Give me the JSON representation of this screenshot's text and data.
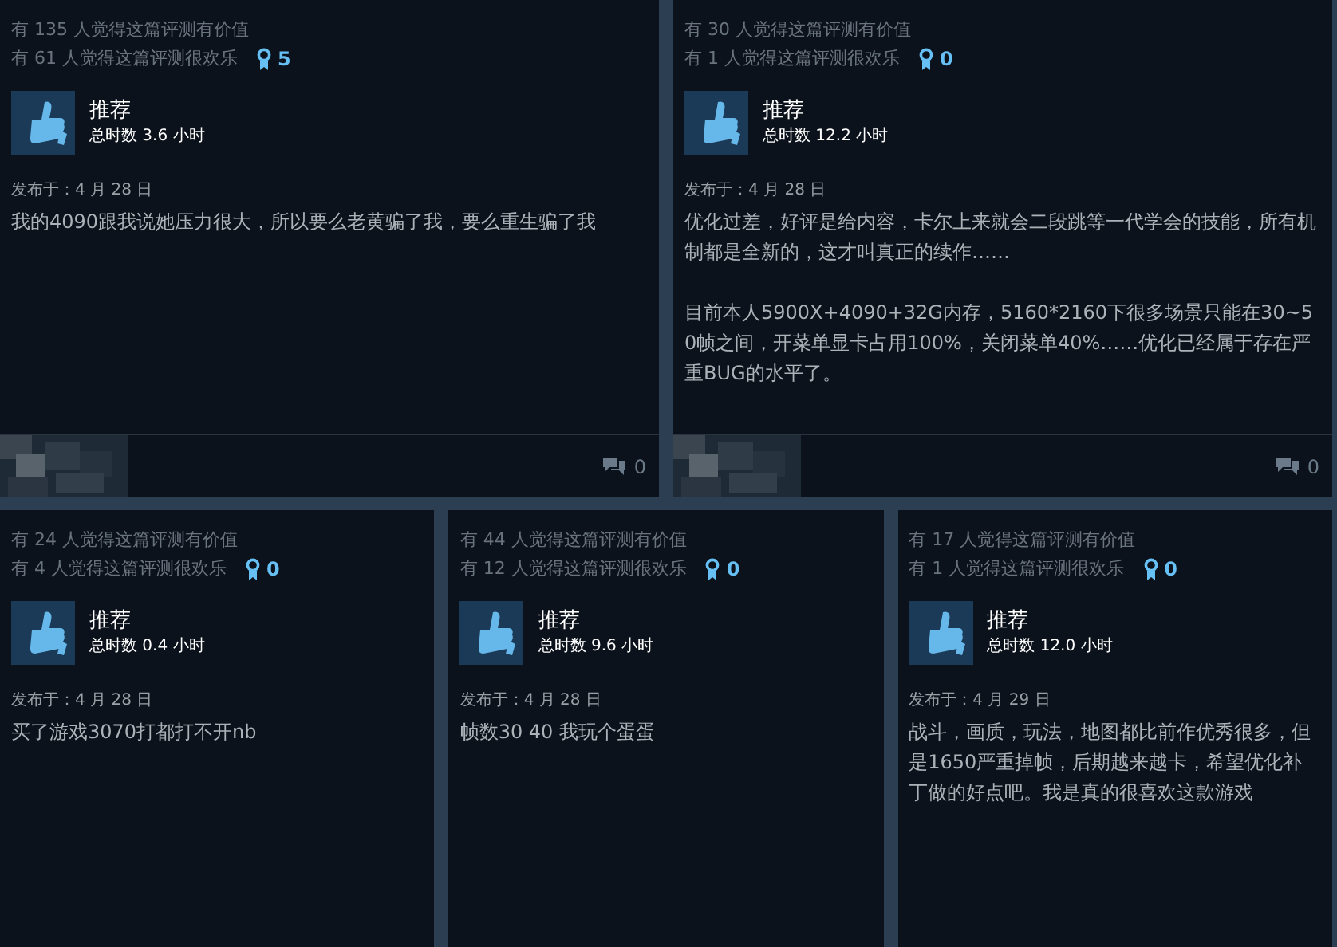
{
  "reviews": [
    {
      "helpful": "有 135 人觉得这篇评测有价值",
      "funny": "有 61 人觉得这篇评测很欢乐",
      "awards": "5",
      "verdict": "推荐",
      "hours": "总时数 3.6 小时",
      "posted": "发布于：4 月 28 日",
      "paragraphs": [
        "我的4090跟我说她压力很大，所以要么老黄骗了我，要么重生骗了我"
      ],
      "comments": "0"
    },
    {
      "helpful": "有 30 人觉得这篇评测有价值",
      "funny": "有 1 人觉得这篇评测很欢乐",
      "awards": "0",
      "verdict": "推荐",
      "hours": "总时数 12.2 小时",
      "posted": "发布于：4 月 28 日",
      "paragraphs": [
        "优化过差，好评是给内容，卡尔上来就会二段跳等一代学会的技能，所有机制都是全新的，这才叫真正的续作……",
        "目前本人5900X+4090+32G内存，5160*2160下很多场景只能在30~50帧之间，开菜单显卡占用100%，关闭菜单40%……优化已经属于存在严重BUG的水平了。"
      ],
      "comments": "0"
    },
    {
      "helpful": "有 24 人觉得这篇评测有价值",
      "funny": "有 4 人觉得这篇评测很欢乐",
      "awards": "0",
      "verdict": "推荐",
      "hours": "总时数 0.4 小时",
      "posted": "发布于：4 月 28 日",
      "paragraphs": [
        "买了游戏3070打都打不开nb"
      ]
    },
    {
      "helpful": "有 44 人觉得这篇评测有价值",
      "funny": "有 12 人觉得这篇评测很欢乐",
      "awards": "0",
      "verdict": "推荐",
      "hours": "总时数 9.6 小时",
      "posted": "发布于：4 月 28 日",
      "paragraphs": [
        "帧数30 40 我玩个蛋蛋"
      ]
    },
    {
      "helpful": "有 17 人觉得这篇评测有价值",
      "funny": "有 1 人觉得这篇评测很欢乐",
      "awards": "0",
      "verdict": "推荐",
      "hours": "总时数 12.0 小时",
      "posted": "发布于：4 月 29 日",
      "paragraphs": [
        "战斗，画质，玩法，地图都比前作优秀很多，但是1650严重掉帧，后期越来越卡，希望优化补丁做的好点吧。我是真的很喜欢这款游戏"
      ]
    }
  ]
}
